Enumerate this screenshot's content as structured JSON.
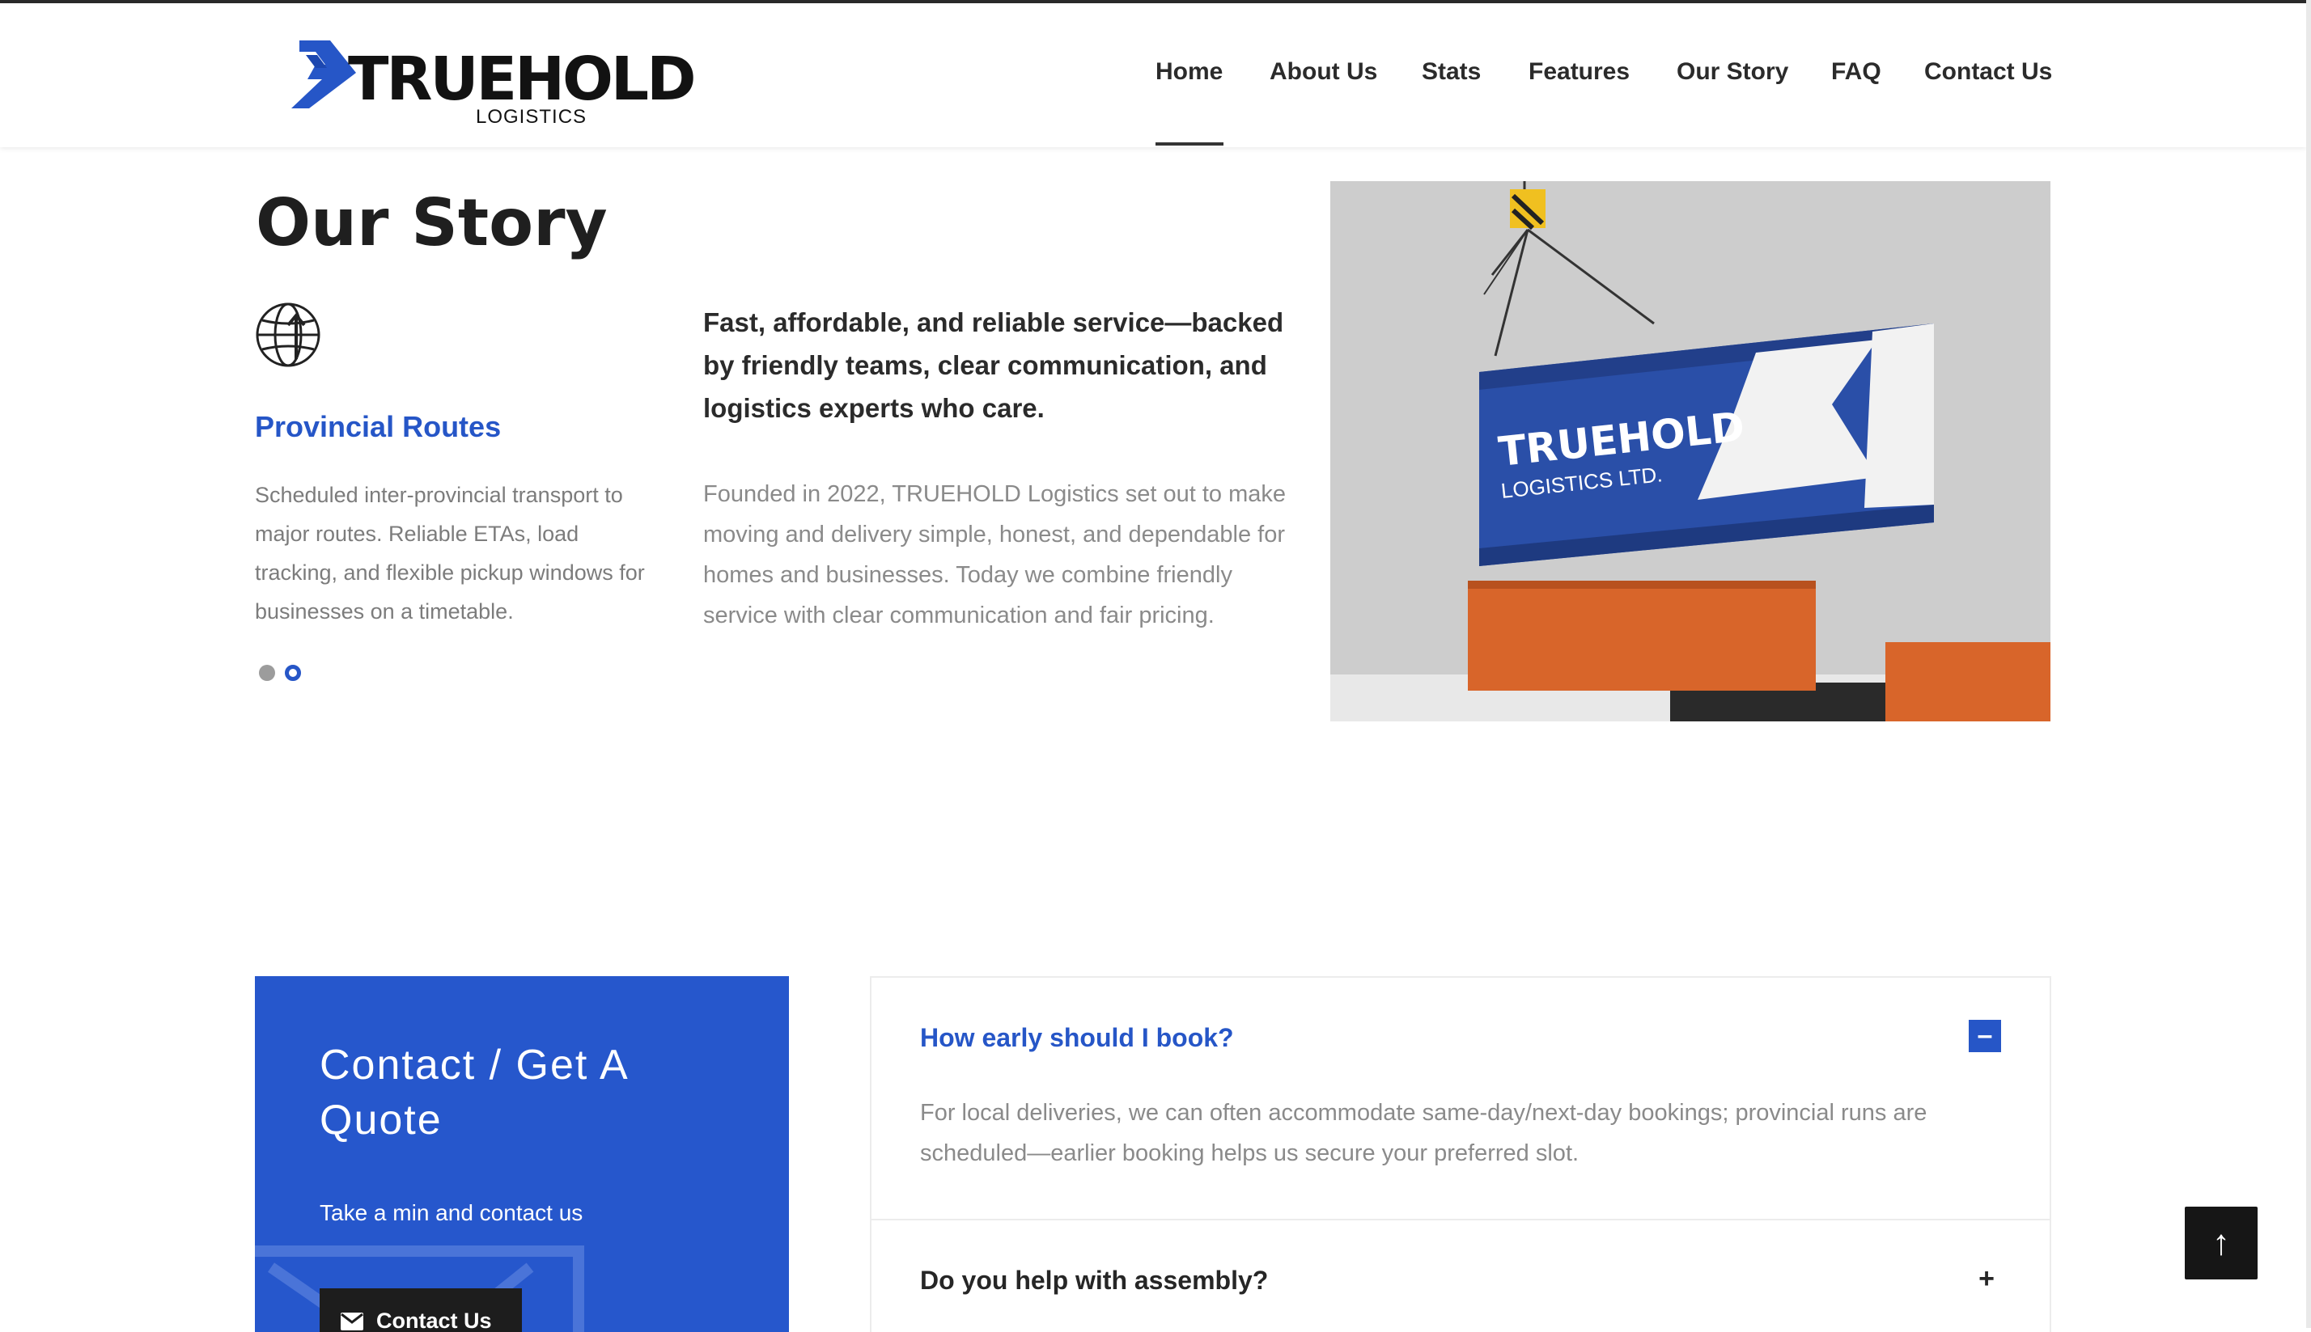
{
  "brand": {
    "name": "TRUEHOLD",
    "tagline": "LOGISTICS",
    "accent_color": "#2656c7",
    "dark_color": "#1d1d1d"
  },
  "nav": {
    "items": [
      {
        "label": "Home",
        "active": true
      },
      {
        "label": "About Us"
      },
      {
        "label": "Stats"
      },
      {
        "label": "Features"
      },
      {
        "label": "Our Story"
      },
      {
        "label": "FAQ"
      },
      {
        "label": "Contact Us"
      }
    ]
  },
  "story": {
    "title": "Our Story",
    "feature_icon": "globe-arrow-icon",
    "feature_title": "Provincial Routes",
    "feature_text": "Scheduled inter-provincial transport to major routes. Reliable ETAs, load tracking, and flexible pickup windows for businesses on a timetable.",
    "slide_count": 2,
    "active_slide": 2,
    "tagline": "Fast, affordable, and reliable service—backed by friendly teams, clear communication, and logistics experts who care.",
    "body": "Founded in 2022, TRUEHOLD Logistics set out to make moving and delivery simple, honest, and dependable for homes and businesses. Today we combine friendly service with clear communication and fair pricing.",
    "photo": {
      "container_brand": "TRUEHOLD",
      "container_sub": "LOGISTICS LTD."
    }
  },
  "quote": {
    "title": "Contact / Get A Quote",
    "subtitle": "Take a min and contact us",
    "button_label": "Contact Us",
    "button_icon": "envelope-icon"
  },
  "faq": {
    "items": [
      {
        "question": "How early should I book?",
        "answer": "For local deliveries, we can often accommodate same-day/next-day bookings; provincial runs are scheduled—earlier booking helps us secure your preferred slot.",
        "expanded": true,
        "toggle": "–"
      },
      {
        "question": "Do you help with assembly?",
        "expanded": false,
        "toggle": "+"
      }
    ]
  },
  "scroll_top": {
    "label": "↑",
    "icon": "arrow-up-icon"
  }
}
